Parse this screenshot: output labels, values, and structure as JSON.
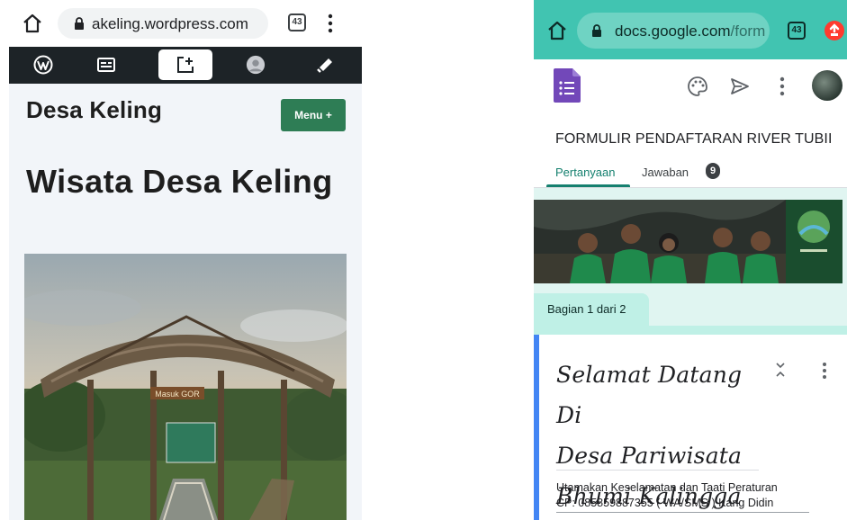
{
  "left_phone": {
    "browser": {
      "url": "akeling.wordpress.com",
      "tab_count": "43",
      "icons": [
        "home-icon",
        "lock-icon",
        "tab-switcher-icon",
        "more-vert-icon"
      ]
    },
    "admin_bar": {
      "icons": [
        "wordpress-logo-icon",
        "reader-icon",
        "new-post-icon",
        "profile-avatar-icon",
        "notifications-bell-icon"
      ]
    },
    "site": {
      "title": "Desa Keling",
      "menu_label": "Menu +",
      "post_title": "Wisata Desa Keling",
      "hero_sign": "Masuk GOR"
    }
  },
  "right_phone": {
    "browser": {
      "url_host": "docs.google.com",
      "url_path": "/form",
      "tab_count": "43",
      "icons": [
        "home-icon",
        "lock-icon",
        "tab-switcher-icon",
        "extension-icon"
      ]
    },
    "forms_toolbar": {
      "icons": [
        "google-forms-logo-icon",
        "palette-icon",
        "send-icon",
        "more-vert-icon",
        "account-avatar"
      ]
    },
    "form": {
      "title": "FORMULIR PENDAFTARAN RIVER TUBII",
      "tabs": [
        {
          "label": "Pertanyaan",
          "active": true
        },
        {
          "label": "Jawaban",
          "badge": "9"
        }
      ],
      "section_label": "Bagian 1 dari 2",
      "welcome_lines": [
        "Selamat Datang Di",
        "Desa Pariwisata",
        "Bhumi Kalingga"
      ],
      "description_lines": [
        "Utamakan Keselamatan dan Taati Peraturan",
        "CP: 085859887355 ( WA/SMS ) Kang Didin"
      ]
    },
    "colors": {
      "accent_teal": "#41c4b1",
      "forms_purple": "#7248b9",
      "section_bg": "#e0f5f1",
      "card_accent": "#4285f4"
    }
  }
}
